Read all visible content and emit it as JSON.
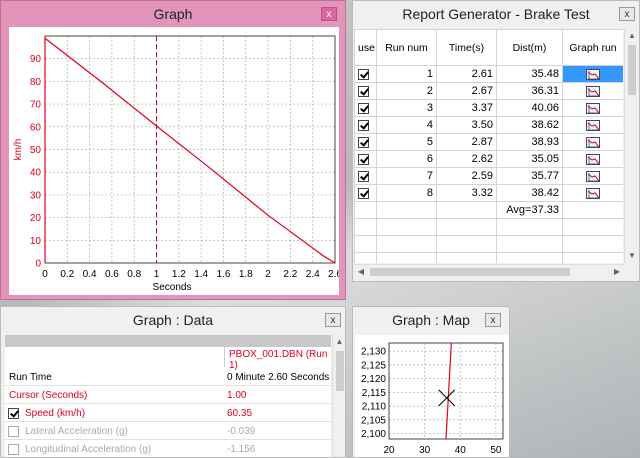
{
  "graph_window": {
    "title": "Graph",
    "close_label": "x"
  },
  "chart_data": {
    "type": "line",
    "title": "",
    "xlabel": "Seconds",
    "ylabel": "km/h",
    "xlim": [
      0,
      2.6
    ],
    "ylim": [
      0,
      100
    ],
    "x_ticks": [
      "0",
      "0.2",
      "0.4",
      "0.6",
      "0.8",
      "1",
      "1.2",
      "1.4",
      "1.6",
      "1.8",
      "2",
      "2.2",
      "2.4",
      "2.6"
    ],
    "y_ticks": [
      "0",
      "10",
      "20",
      "30",
      "40",
      "50",
      "60",
      "70",
      "80",
      "90"
    ],
    "grid": true,
    "cursor_x": 1.0,
    "series": [
      {
        "x": [
          0,
          0.5,
          1.0,
          1.5,
          2.0,
          2.5,
          2.6
        ],
        "y": [
          99,
          80,
          60.35,
          41,
          21,
          3,
          0
        ],
        "color": "#e0001b"
      }
    ]
  },
  "report": {
    "title": "Report Generator - Brake Test",
    "close_label": "x",
    "columns": [
      "use",
      "Run num",
      "Time(s)",
      "Dist(m)",
      "Graph run"
    ],
    "rows": [
      {
        "use": true,
        "run": "1",
        "time": "2.61",
        "dist": "35.48",
        "selected": true
      },
      {
        "use": true,
        "run": "2",
        "time": "2.67",
        "dist": "36.31",
        "selected": false
      },
      {
        "use": true,
        "run": "3",
        "time": "3.37",
        "dist": "40.06",
        "selected": false
      },
      {
        "use": true,
        "run": "4",
        "time": "3.50",
        "dist": "38.62",
        "selected": false
      },
      {
        "use": true,
        "run": "5",
        "time": "2.87",
        "dist": "38.93",
        "selected": false
      },
      {
        "use": true,
        "run": "6",
        "time": "2.62",
        "dist": "35.05",
        "selected": false
      },
      {
        "use": true,
        "run": "7",
        "time": "2.59",
        "dist": "35.77",
        "selected": false
      },
      {
        "use": true,
        "run": "8",
        "time": "3.32",
        "dist": "38.42",
        "selected": false
      }
    ],
    "average": "Avg=37.33"
  },
  "data_window": {
    "title": "Graph : Data",
    "close_label": "x",
    "file_label": "PBOX_001.DBN (Run 1)",
    "rows": [
      {
        "label": "Run Time",
        "value": "0 Minute 2.60 Seconds",
        "style": "normal",
        "checkbox": "none"
      },
      {
        "label": "Cursor (Seconds)",
        "value": "1.00",
        "style": "red",
        "checkbox": "none"
      },
      {
        "label": "Speed (km/h)",
        "value": "60.35",
        "style": "red",
        "checkbox": "on"
      },
      {
        "label": "Lateral Acceleration (g)",
        "value": "-0.039",
        "style": "grey",
        "checkbox": "off"
      },
      {
        "label": "Longitudinal Acceleration (g)",
        "value": "-1.156",
        "style": "grey",
        "checkbox": "off"
      }
    ]
  },
  "map_window": {
    "title": "Graph : Map",
    "close_label": "x",
    "map": {
      "x_ticks": [
        "20",
        "30",
        "40",
        "50"
      ],
      "y_ticks": [
        "2,130",
        "2,125",
        "2,120",
        "2,115",
        "2,110",
        "2,105",
        "2,100"
      ],
      "xlim": [
        20,
        52
      ],
      "ylim": [
        2098,
        2133
      ],
      "track_x": [
        37.5,
        37.2,
        36.9,
        36.6,
        36.3,
        36.0
      ],
      "track_y": [
        2133,
        2126,
        2119,
        2112,
        2105,
        2098
      ],
      "marker": [
        36.2,
        2113
      ],
      "track_color": "#e0001b"
    }
  }
}
